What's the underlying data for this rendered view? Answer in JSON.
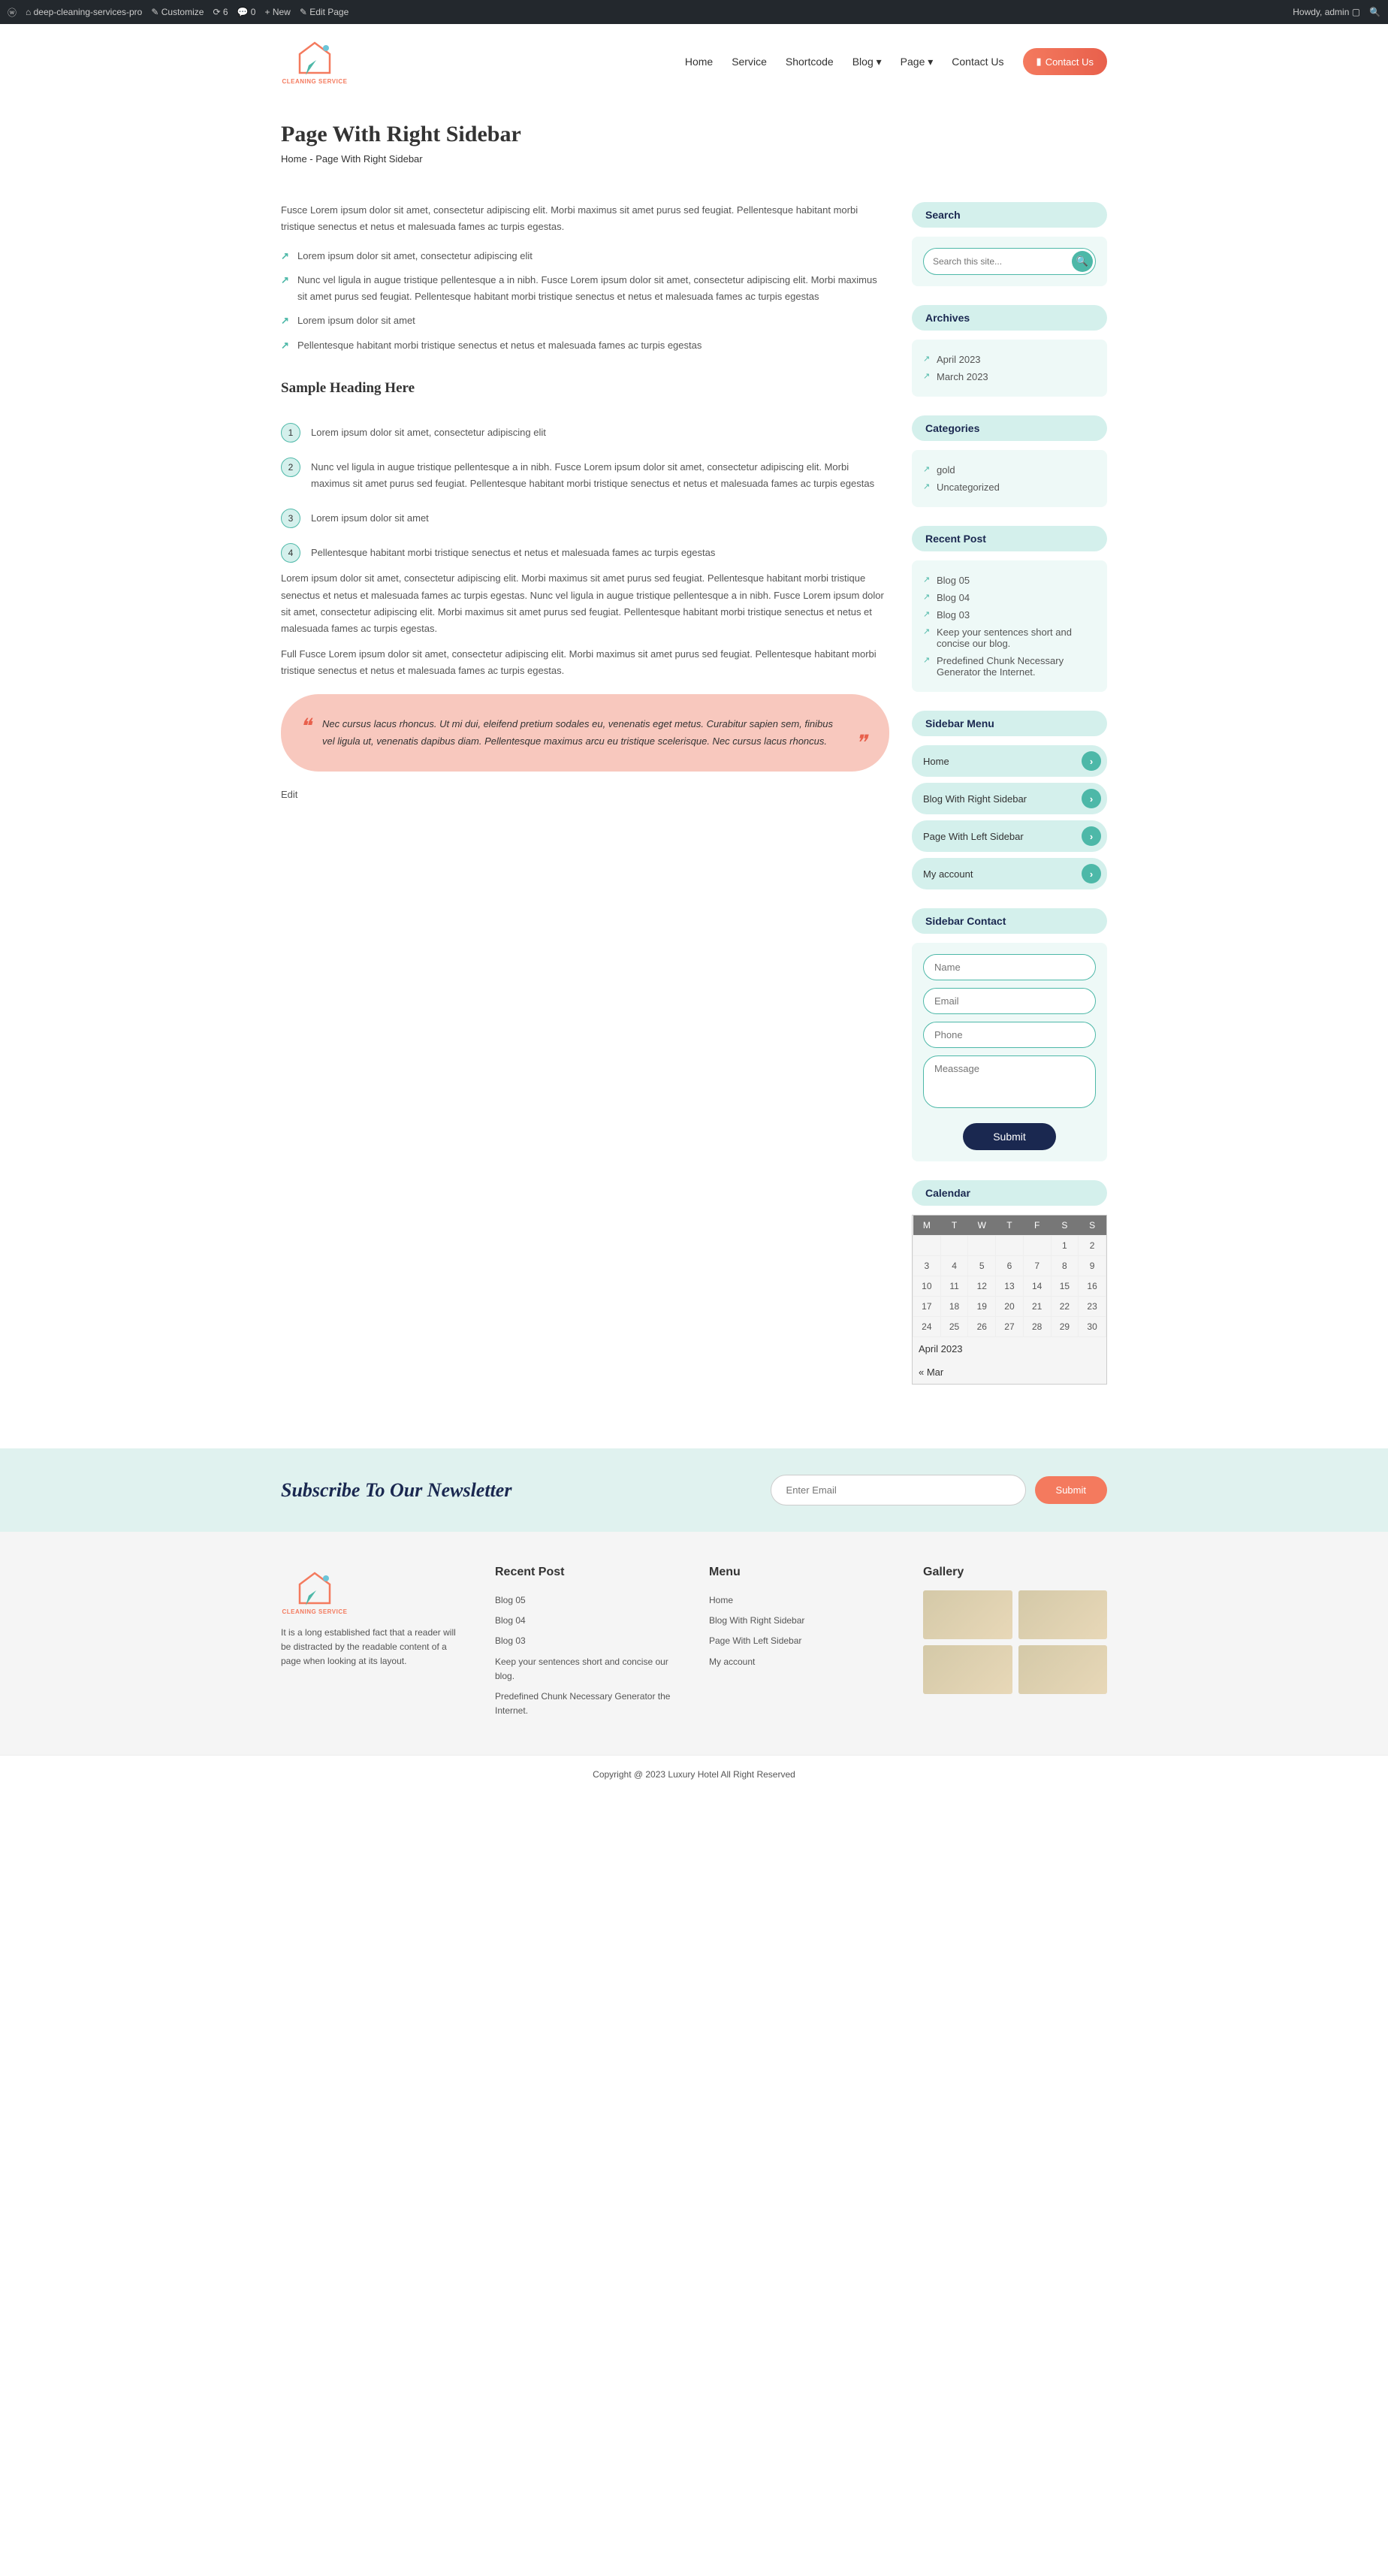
{
  "adminBar": {
    "site": "deep-cleaning-services-pro",
    "customize": "Customize",
    "updates": "6",
    "comments": "0",
    "new": "New",
    "editPage": "Edit Page",
    "howdy": "Howdy, admin"
  },
  "nav": {
    "home": "Home",
    "service": "Service",
    "shortcode": "Shortcode",
    "blog": "Blog",
    "page": "Page",
    "contact": "Contact Us",
    "contactBtn": "Contact Us"
  },
  "pageTitle": "Page With Right Sidebar",
  "breadcrumb": {
    "home": "Home",
    "sep": " -  ",
    "current": "Page With Right Sidebar"
  },
  "content": {
    "intro": "Fusce Lorem ipsum dolor sit amet, consectetur adipiscing elit. Morbi maximus sit amet purus sed feugiat. Pellentesque habitant morbi tristique senectus et netus et malesuada fames ac turpis egestas.",
    "arrows": [
      "Lorem ipsum dolor sit amet, consectetur adipiscing elit",
      "Nunc vel ligula in augue tristique pellentesque a in nibh. Fusce Lorem ipsum dolor sit amet, consectetur adipiscing elit. Morbi maximus sit amet purus sed feugiat. Pellentesque habitant morbi tristique senectus et netus et malesuada fames ac turpis egestas",
      "Lorem ipsum dolor sit amet",
      "Pellentesque habitant morbi tristique senectus et netus et malesuada fames ac turpis egestas"
    ],
    "sampleHeading": "Sample Heading Here",
    "numbered": [
      "Lorem ipsum dolor sit amet, consectetur adipiscing elit",
      "Nunc vel ligula in augue tristique pellentesque a in nibh. Fusce Lorem ipsum dolor sit amet, consectetur adipiscing elit. Morbi maximus sit amet purus sed feugiat. Pellentesque habitant morbi tristique senectus et netus et malesuada fames ac turpis egestas",
      "Lorem ipsum dolor sit amet",
      "Pellentesque habitant morbi tristique senectus et netus et malesuada fames ac turpis egestas"
    ],
    "para1": "Lorem ipsum dolor sit amet, consectetur adipiscing elit. Morbi maximus sit amet purus sed feugiat. Pellentesque habitant morbi tristique senectus et netus et malesuada fames ac turpis egestas. Nunc vel ligula in augue tristique pellentesque a in nibh. Fusce Lorem ipsum dolor sit amet, consectetur adipiscing elit. Morbi maximus sit amet purus sed feugiat. Pellentesque habitant morbi tristique senectus et netus et malesuada fames ac turpis egestas.",
    "para2": "Full Fusce Lorem ipsum dolor sit amet, consectetur adipiscing elit. Morbi maximus sit amet purus sed feugiat. Pellentesque habitant morbi tristique senectus et netus et malesuada fames ac turpis egestas.",
    "quote": "Nec cursus lacus rhoncus. Ut mi dui, eleifend pretium sodales eu, venenatis eget metus. Curabitur sapien sem, finibus vel ligula ut, venenatis dapibus diam. Pellentesque maximus arcu eu tristique scelerisque. Nec cursus lacus rhoncus.",
    "edit": "Edit"
  },
  "sidebar": {
    "search": {
      "title": "Search",
      "placeholder": "Search this site..."
    },
    "archives": {
      "title": "Archives",
      "items": [
        "April 2023",
        "March 2023"
      ]
    },
    "categories": {
      "title": "Categories",
      "items": [
        "gold",
        "Uncategorized"
      ]
    },
    "recent": {
      "title": "Recent Post",
      "items": [
        "Blog 05",
        "Blog 04",
        "Blog 03",
        "Keep your sentences short and concise our blog.",
        "Predefined Chunk Necessary Generator the Internet."
      ]
    },
    "menu": {
      "title": "Sidebar Menu",
      "items": [
        "Home",
        "Blog With Right Sidebar",
        "Page With Left Sidebar",
        "My account"
      ]
    },
    "contact": {
      "title": "Sidebar Contact",
      "name": "Name",
      "email": "Email",
      "phone": "Phone",
      "message": "Meassage",
      "submit": "Submit"
    },
    "calendar": {
      "title": "Calendar",
      "caption": "April 2023",
      "prev": "« Mar",
      "days": [
        "M",
        "T",
        "W",
        "T",
        "F",
        "S",
        "S"
      ]
    }
  },
  "newsletter": {
    "title": "Subscribe To Our Newsletter",
    "placeholder": "Enter Email",
    "submit": "Submit"
  },
  "footer": {
    "about": "It is a long established fact that a reader will be distracted by the readable content of a page when looking at its layout.",
    "recentTitle": "Recent Post",
    "recent": [
      "Blog 05",
      "Blog 04",
      "Blog 03",
      "Keep your sentences short and concise our blog.",
      "Predefined Chunk Necessary Generator the Internet."
    ],
    "menuTitle": "Menu",
    "menu": [
      "Home",
      "Blog With Right Sidebar",
      "Page With Left Sidebar",
      "My account"
    ],
    "galleryTitle": "Gallery"
  },
  "copyright": "Copyright @ 2023 Luxury Hotel All Right Reserved",
  "logoText": "CLEANING SERVICE"
}
